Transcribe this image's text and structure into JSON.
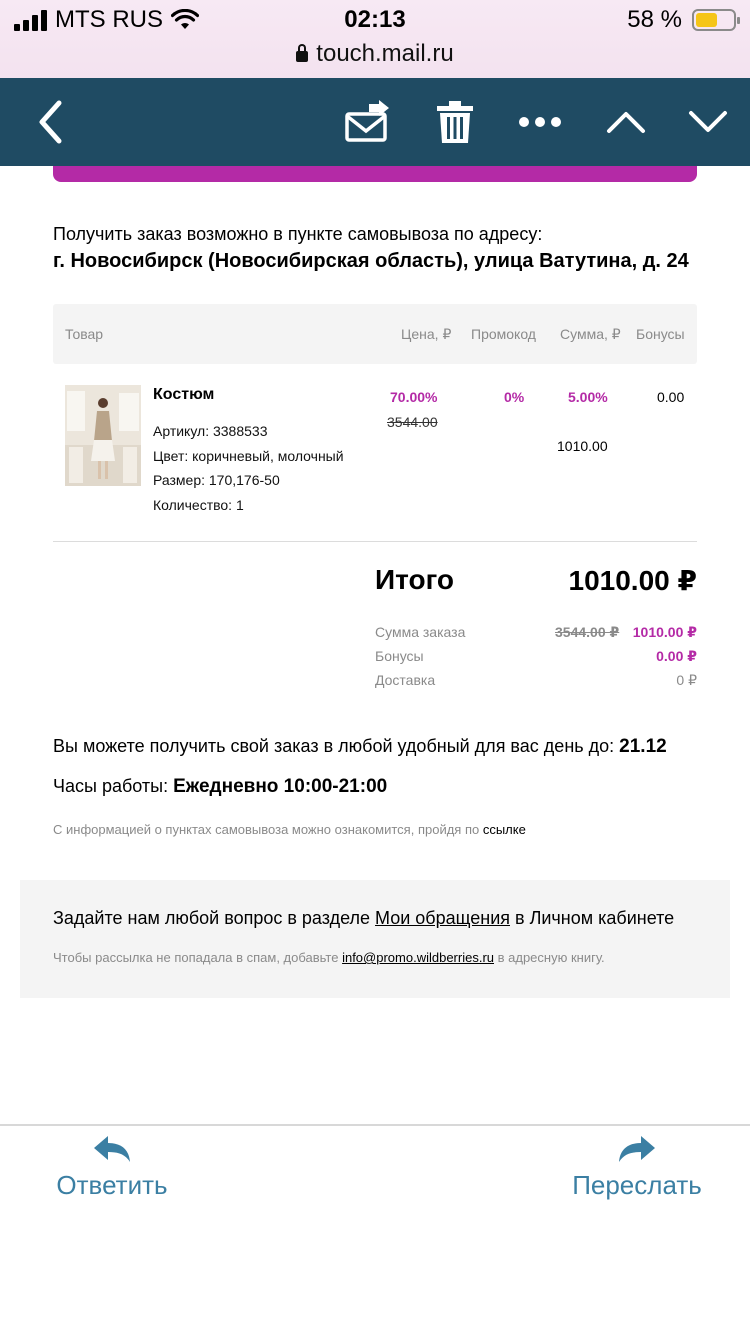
{
  "status_bar": {
    "carrier": "MTS RUS",
    "time": "02:13",
    "battery_percent": "58 %",
    "battery_level": 0.58,
    "url": "touch.mail.ru"
  },
  "toolbar": {
    "back": "chevron-left-icon",
    "move": "envelope-move-icon",
    "delete": "trash-icon",
    "more": "more-dots-icon",
    "prev": "chevron-up-icon",
    "next": "chevron-down-icon"
  },
  "pickup": {
    "intro": "Получить заказ возможно в пункте самовывоза по адресу:",
    "address": "г. Новосибирск (Новосибирская область), улица Ватутина, д. 24"
  },
  "table": {
    "headers": [
      "Товар",
      "Цена, ₽",
      "Промокод",
      "Сумма, ₽",
      "Бонусы"
    ],
    "item": {
      "name": "Костюм",
      "article": "Артикул: 3388533",
      "color": "Цвет: коричневый, молочный",
      "size": "Размер: 170,176-50",
      "quantity": "Количество: 1",
      "price_discount": "70.00%",
      "price_old": "3544.00",
      "promo": "0%",
      "sum_discount": "5.00%",
      "sum": "1010.00",
      "bonus": "0.00"
    }
  },
  "totals": {
    "label": "Итого",
    "value": "1010.00 ₽",
    "order_sum_label": "Сумма заказа",
    "order_sum_old": "3544.00 ₽",
    "order_sum_new": "1010.00 ₽",
    "bonus_label": "Бонусы",
    "bonus_value": "0.00 ₽",
    "delivery_label": "Доставка",
    "delivery_value": "0 ₽"
  },
  "pickup_info": {
    "until_text": "Вы можете получить свой заказ в любой удобный для вас день до: ",
    "until_date": "21.12",
    "hours_label": "Часы работы: ",
    "hours_value": "Ежедневно 10:00-21:00",
    "info_text": "С информацией о пунктах самовывоза можно ознакомится, пройдя по ",
    "info_link": "ссылке"
  },
  "support": {
    "ask_before": "Задайте нам любой вопрос в разделе ",
    "ask_link": "Мои обращения",
    "ask_after": " в Личном кабинете",
    "spam_before": "Чтобы рассылка не попадала в спам, добавьте ",
    "spam_link": "info@promo.wildberries.ru",
    "spam_after": " в адресную книгу."
  },
  "actions": {
    "reply": "Ответить",
    "forward": "Переслать"
  },
  "colors": {
    "toolbar": "#1f4b63",
    "accent_purple": "#b42aa6",
    "action_blue": "#3b7fa3"
  }
}
